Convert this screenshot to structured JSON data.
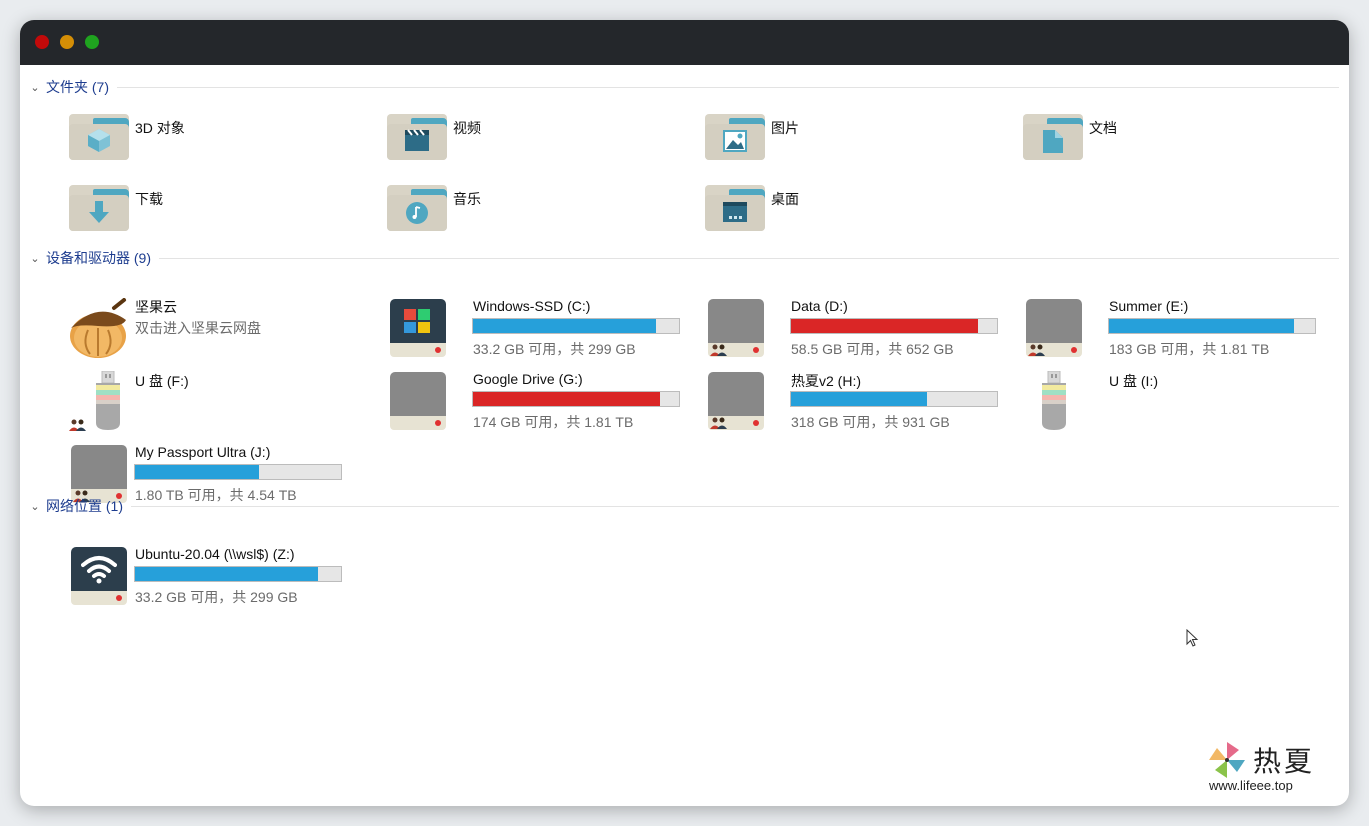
{
  "sections": {
    "folders": {
      "title": "文件夹 (7)"
    },
    "devices": {
      "title": "设备和驱动器 (9)"
    },
    "network": {
      "title": "网络位置 (1)"
    }
  },
  "folders": {
    "objects3d": "3D 对象",
    "videos": "视频",
    "pictures": "图片",
    "documents": "文档",
    "downloads": "下载",
    "music": "音乐",
    "desktop": "桌面"
  },
  "devices": {
    "jianguoyun": {
      "name": "坚果云",
      "sub": "双击进入坚果云网盘"
    },
    "c": {
      "name": "Windows-SSD (C:)",
      "sub": "33.2 GB 可用，共 299 GB",
      "used_fraction": 0.89,
      "color": "#26a0da"
    },
    "d": {
      "name": "Data (D:)",
      "sub": "58.5 GB 可用，共 652 GB",
      "used_fraction": 0.91,
      "color": "#da2626"
    },
    "e": {
      "name": "Summer (E:)",
      "sub": "183 GB 可用，共 1.81 TB",
      "used_fraction": 0.9,
      "color": "#26a0da"
    },
    "f": {
      "name": "U 盘 (F:)"
    },
    "g": {
      "name": "Google Drive (G:)",
      "sub": "174 GB 可用，共 1.81 TB",
      "used_fraction": 0.91,
      "color": "#da2626"
    },
    "h": {
      "name": "热夏v2 (H:)",
      "sub": "318 GB 可用，共 931 GB",
      "used_fraction": 0.66,
      "color": "#26a0da"
    },
    "i": {
      "name": "U 盘 (I:)"
    },
    "j": {
      "name": "My Passport Ultra (J:)",
      "sub": "1.80 TB 可用，共 4.54 TB",
      "used_fraction": 0.6,
      "color": "#26a0da"
    }
  },
  "network": {
    "z": {
      "name": "Ubuntu-20.04 (\\\\wsl$) (Z:)",
      "sub": "33.2 GB 可用，共 299 GB",
      "used_fraction": 0.89,
      "color": "#26a0da"
    }
  },
  "watermark": {
    "text": "热夏",
    "url": "www.lifeee.top"
  }
}
